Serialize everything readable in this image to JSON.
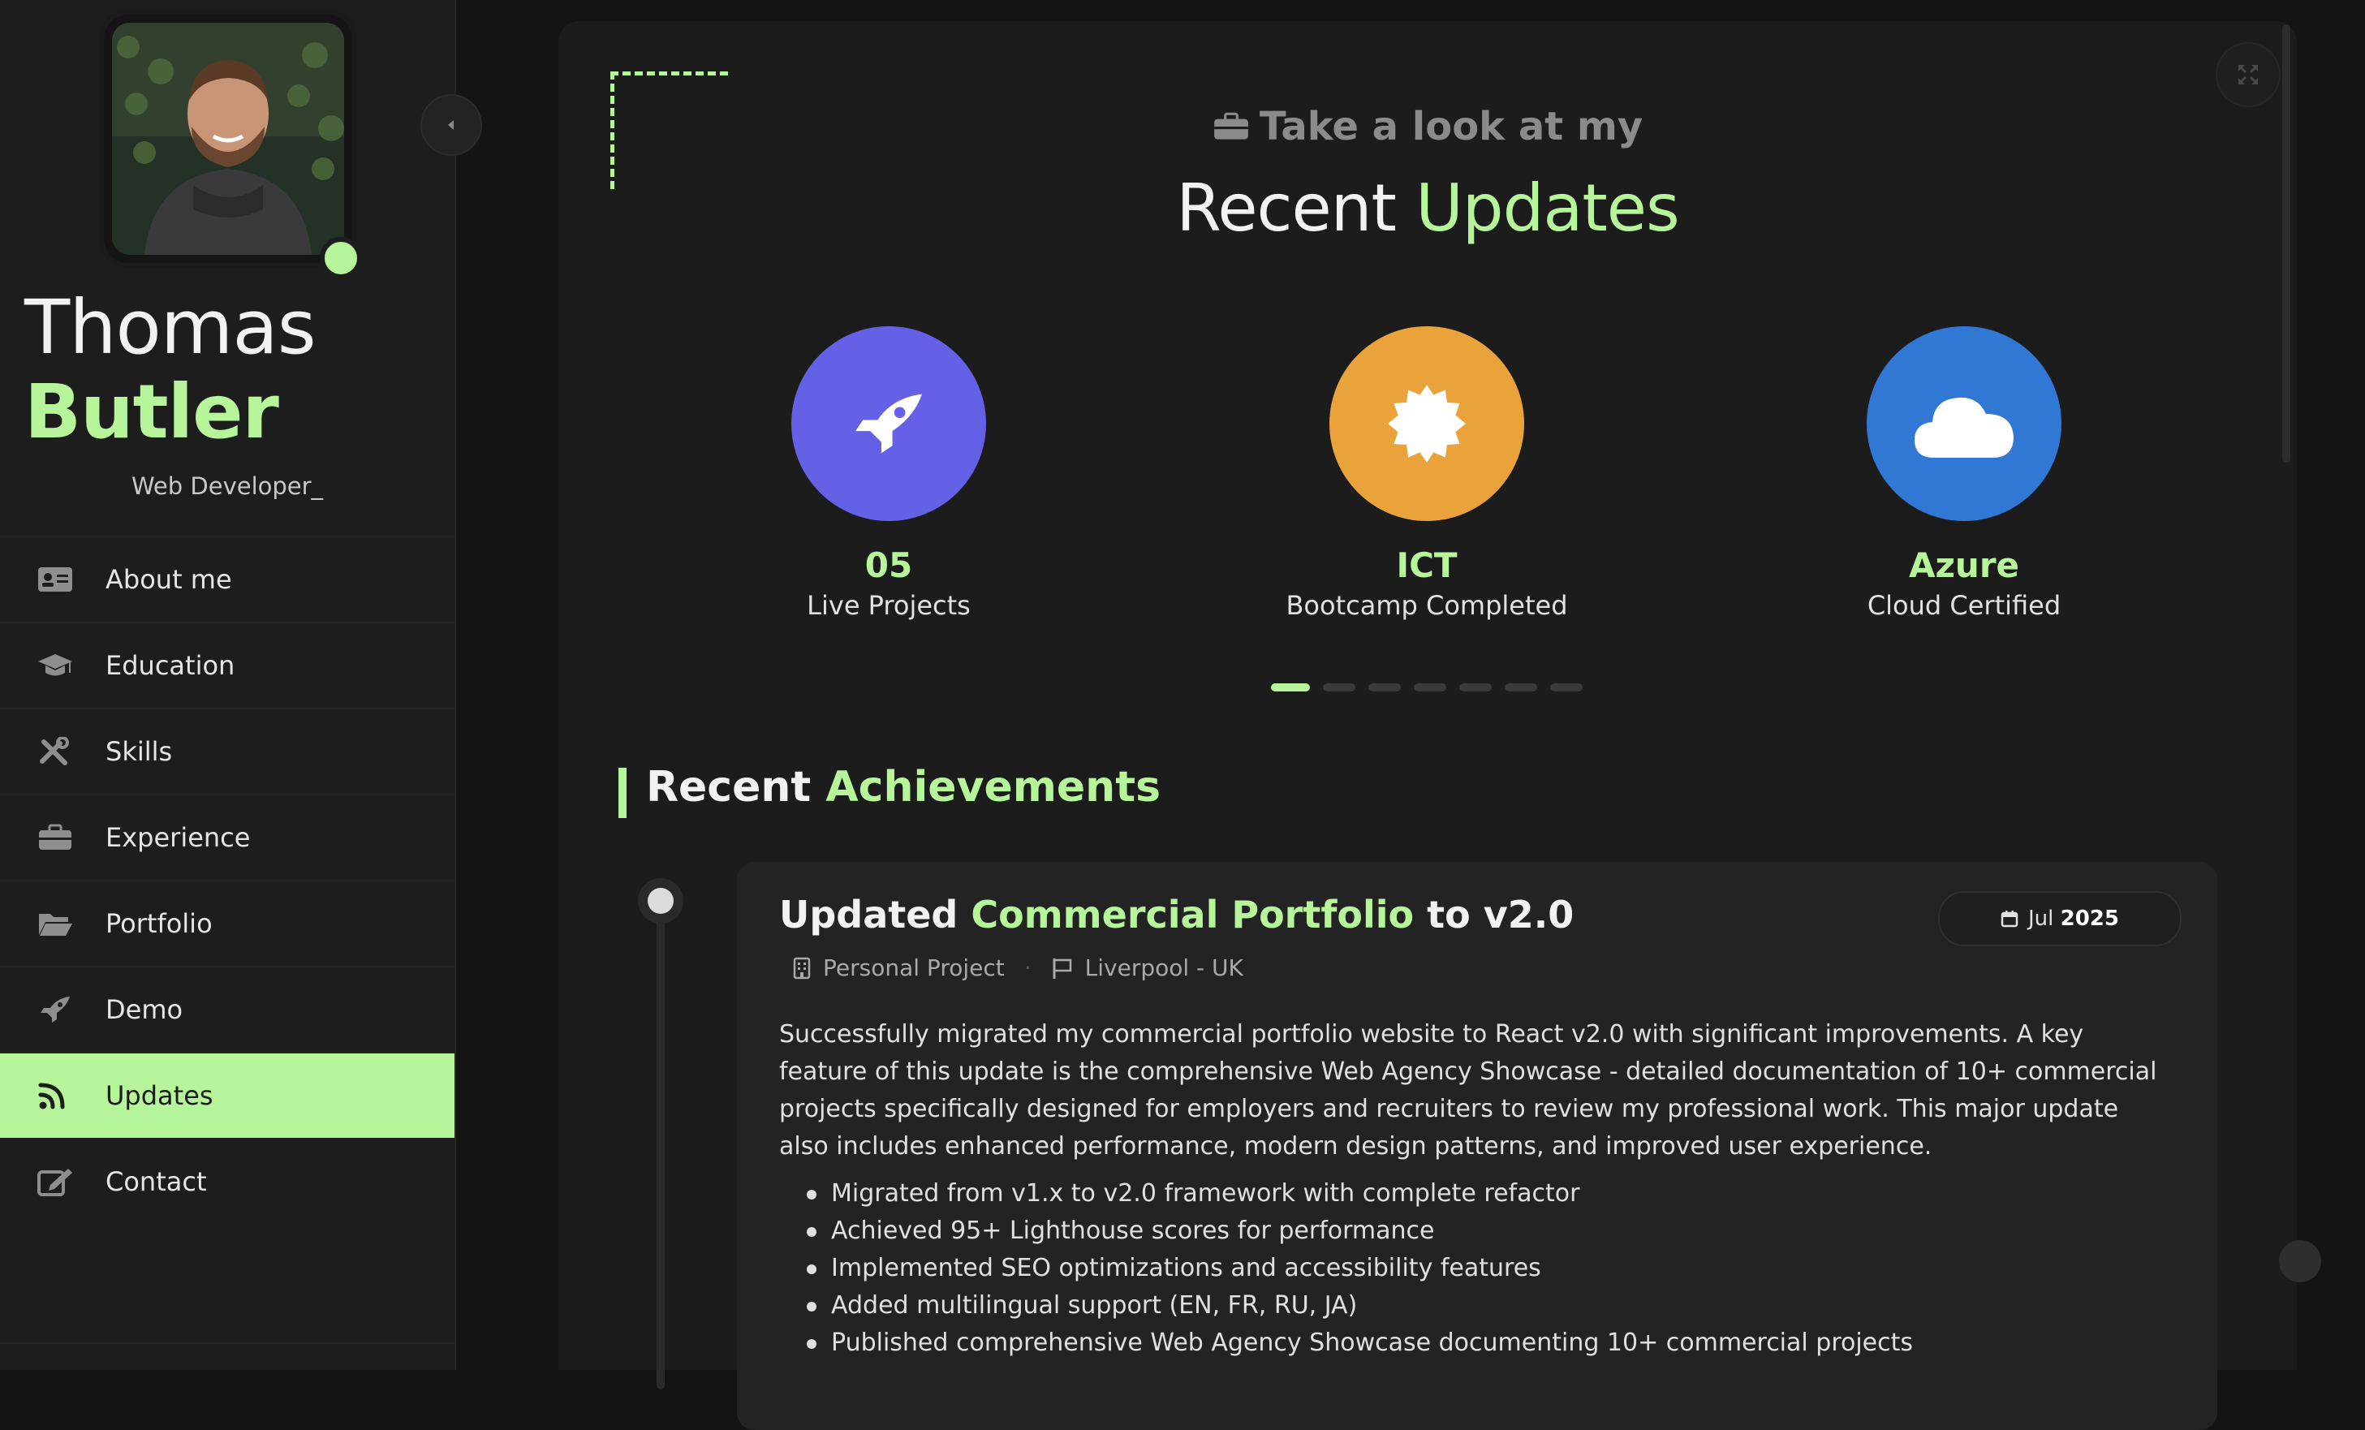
{
  "profile": {
    "first_name": "Thomas",
    "last_name": "Butler",
    "role": "Web Developer_",
    "status": "online"
  },
  "nav": {
    "items": [
      {
        "label": "About me",
        "icon": "id-card-icon"
      },
      {
        "label": "Education",
        "icon": "graduation-cap-icon"
      },
      {
        "label": "Skills",
        "icon": "tools-icon"
      },
      {
        "label": "Experience",
        "icon": "briefcase-icon"
      },
      {
        "label": "Portfolio",
        "icon": "folder-open-icon"
      },
      {
        "label": "Demo",
        "icon": "rocket-icon"
      },
      {
        "label": "Updates",
        "icon": "rss-icon"
      },
      {
        "label": "Contact",
        "icon": "edit-icon"
      }
    ],
    "active": "Updates"
  },
  "header": {
    "kicker": "Take a look at my",
    "title_plain": "Recent",
    "title_accent": "Updates"
  },
  "stats": [
    {
      "value": "05",
      "label": "Live Projects",
      "icon": "rocket-icon",
      "color": "#6461e6"
    },
    {
      "value": "ICT",
      "label": "Bootcamp Completed",
      "icon": "certificate-icon",
      "color": "#eaa33a"
    },
    {
      "value": "Azure",
      "label": "Cloud Certified",
      "icon": "cloud-icon",
      "color": "#3177d4"
    }
  ],
  "carousel": {
    "count": 7,
    "active_index": 0
  },
  "section": {
    "title_plain": "Recent",
    "title_accent": "Achievements"
  },
  "achievement": {
    "title_pre": "Updated",
    "title_accent": "Commercial Portfolio",
    "title_post": "to v2.0",
    "date_month": "Jul",
    "date_year": "2025",
    "org": "Personal Project",
    "location": "Liverpool - UK",
    "description": "Successfully migrated my commercial portfolio website to React v2.0 with significant improvements. A key feature of this update is the comprehensive Web Agency Showcase - detailed documentation of 10+ commercial projects specifically designed for employers and recruiters to review my professional work. This major update also includes enhanced performance, modern design patterns, and improved user experience.",
    "bullets": [
      "Migrated from v1.x to v2.0 framework with complete refactor",
      "Achieved 95+ Lighthouse scores for performance",
      "Implemented SEO optimizations and accessibility features",
      "Added multilingual support (EN, FR, RU, JA)",
      "Published comprehensive Web Agency Showcase documenting 10+ commercial projects"
    ]
  },
  "colors": {
    "accent": "#b6f59a",
    "background": "#141414",
    "sidebar": "#1d1d1d",
    "panel": "#1c1c1c"
  }
}
